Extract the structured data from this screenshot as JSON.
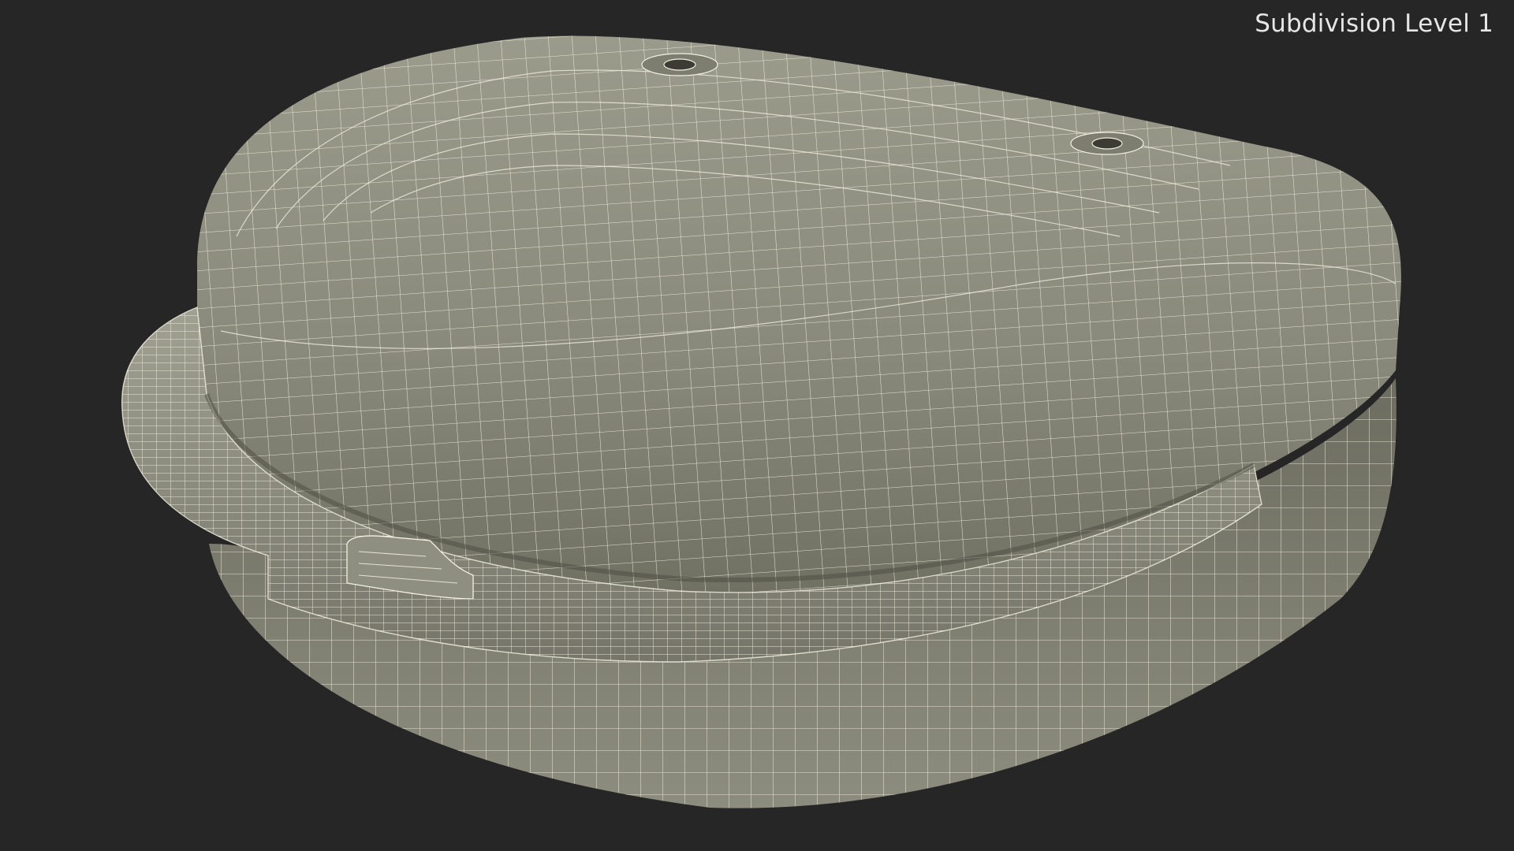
{
  "overlay": {
    "subdivision_label": "Subdivision Level 1"
  },
  "colors": {
    "background": "#262626",
    "surface": "#8a8a7c",
    "surface_shadow": "#5e5e53",
    "wire": "#f4f1e2",
    "label": "#e6e6e6"
  },
  "icons": [
    "mouthguard-case-model-icon"
  ]
}
